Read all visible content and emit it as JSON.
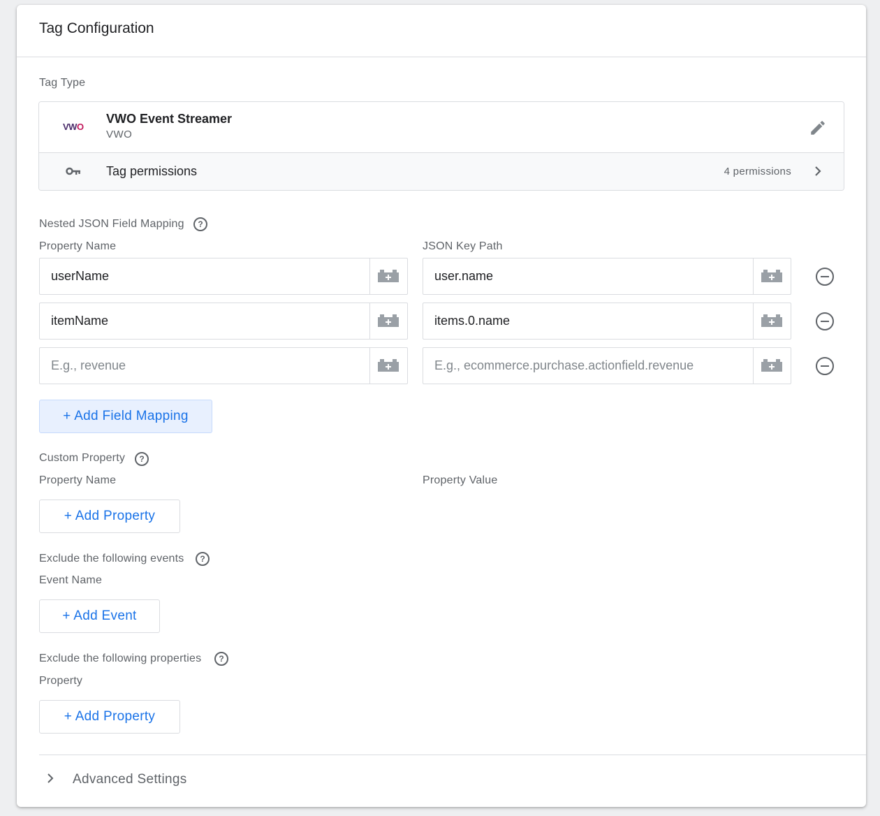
{
  "card": {
    "title": "Tag Configuration"
  },
  "tag_type": {
    "section_label": "Tag Type",
    "logo_text_v": "VW",
    "logo_text_o": "O",
    "name": "VWO Event Streamer",
    "vendor": "VWO",
    "permissions_label": "Tag permissions",
    "permissions_count": "4 permissions"
  },
  "nested_mapping": {
    "section_label": "Nested JSON Field Mapping",
    "col_property": "Property Name",
    "col_key_path": "JSON Key Path",
    "rows": [
      {
        "property": "userName",
        "key_path": "user.name"
      },
      {
        "property": "itemName",
        "key_path": "items.0.name"
      },
      {
        "property_placeholder": "E.g., revenue",
        "key_path_placeholder": "E.g., ecommerce.purchase.actionfield.revenue"
      }
    ],
    "add_button": "+ Add Field Mapping"
  },
  "custom_property": {
    "section_label": "Custom Property",
    "col_name": "Property Name",
    "col_value": "Property Value",
    "add_button": "+ Add Property"
  },
  "exclude_events": {
    "section_label": "Exclude the following events",
    "col_name": "Event Name",
    "add_button": "+ Add Event"
  },
  "exclude_properties": {
    "section_label": "Exclude the following properties",
    "col_name": "Property",
    "add_button": "+ Add Property"
  },
  "advanced": {
    "label": "Advanced Settings"
  },
  "help_glyph": "?",
  "colors": {
    "accent": "#1a73e8",
    "text_secondary": "#5f6368",
    "border": "#dadce0"
  }
}
